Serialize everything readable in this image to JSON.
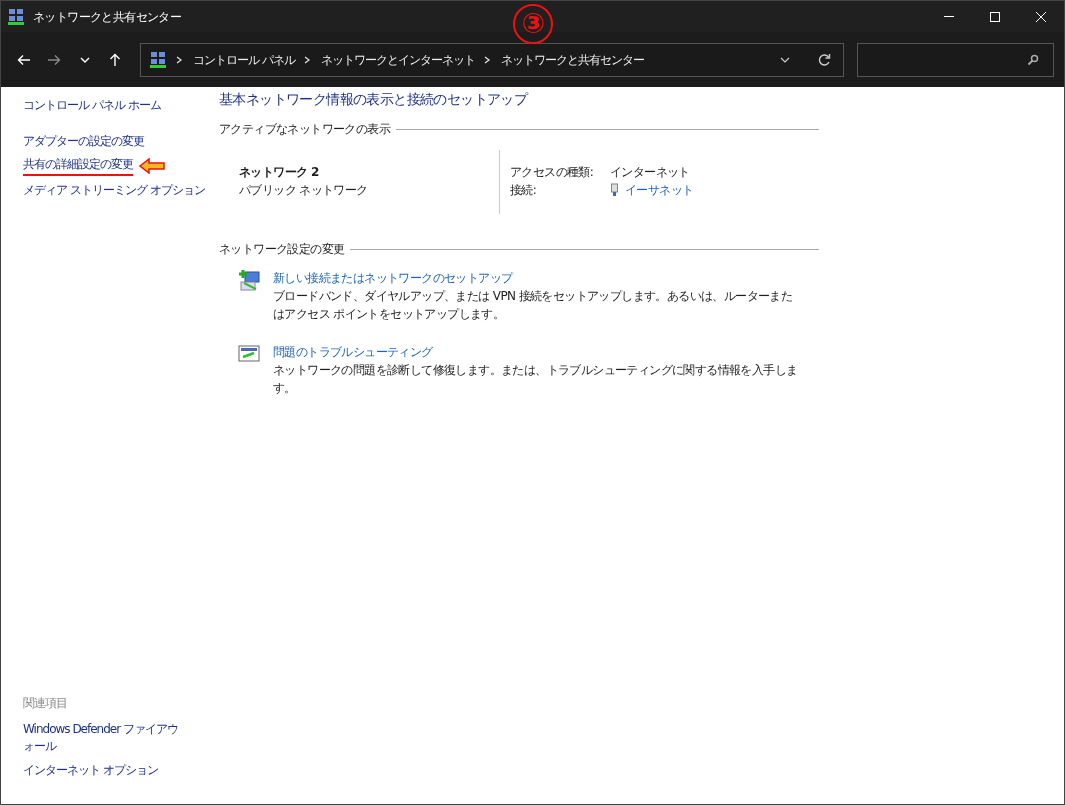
{
  "window": {
    "title": "ネットワークと共有センター"
  },
  "nav_buttons": [
    {
      "kind": "back",
      "disabled": false
    },
    {
      "kind": "forward",
      "disabled": true
    },
    {
      "kind": "recent",
      "disabled": false
    },
    {
      "kind": "up",
      "disabled": false
    }
  ],
  "breadcrumb": [
    "コントロール パネル",
    "ネットワークとインターネット",
    "ネットワークと共有センター"
  ],
  "sidebar": {
    "links": [
      {
        "label": "コントロール パネル ホーム",
        "highlighted": false
      },
      {
        "label": "アダプターの設定の変更",
        "highlighted": false
      },
      {
        "label": "共有の詳細設定の変更",
        "highlighted": true
      },
      {
        "label": "メディア ストリーミング オプション",
        "highlighted": false
      }
    ],
    "related_heading": "関連項目",
    "related_links": [
      "Windows Defender ファイアウォール",
      "インターネット オプション"
    ]
  },
  "main": {
    "heading": "基本ネットワーク情報の表示と接続のセットアップ",
    "active_section": {
      "title": "アクティブなネットワークの表示",
      "network_name": "ネットワーク 2",
      "network_type": "パブリック ネットワーク",
      "properties": [
        {
          "label": "アクセスの種類:",
          "value": "インターネット",
          "kind": "text"
        },
        {
          "label": "接続:",
          "value": "イーサネット",
          "kind": "link"
        }
      ]
    },
    "settings_section": {
      "title": "ネットワーク設定の変更",
      "tasks": [
        {
          "kind": "new-connection",
          "title": "新しい接続またはネットワークのセットアップ",
          "description": "ブロードバンド、ダイヤルアップ、または VPN 接続をセットアップします。あるいは、ルーターまたはアクセス ポイントをセットアップします。"
        },
        {
          "kind": "troubleshoot",
          "title": "問題のトラブルシューティング",
          "description": "ネットワークの問題を診断して修復します。または、トラブルシューティングに関する情報を入手します。"
        }
      ]
    }
  },
  "annotation": {
    "step": "③"
  }
}
